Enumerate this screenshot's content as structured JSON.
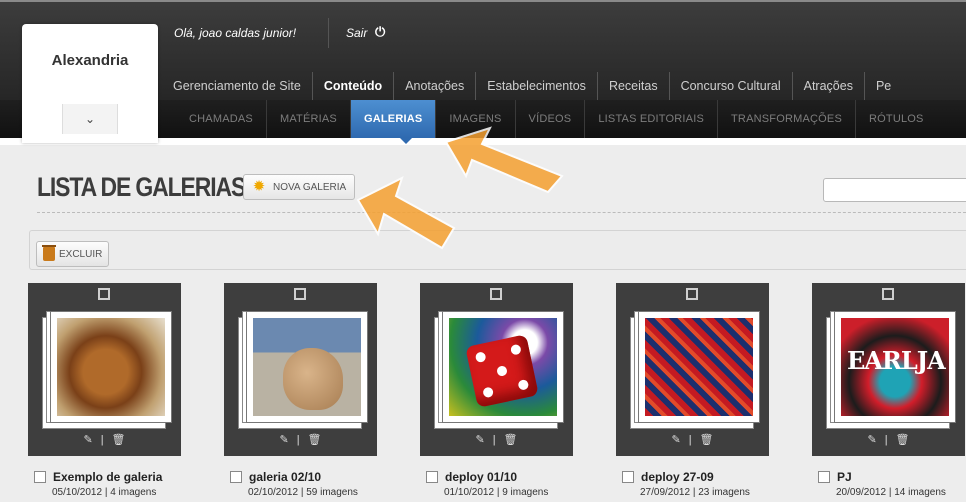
{
  "header": {
    "greeting": "Olá, joao caldas junior!",
    "logout_label": "Sair",
    "logout_icon": "power-icon"
  },
  "site_selector": {
    "name": "Alexandria",
    "toggle_icon": "chevron-down-icon"
  },
  "main_nav": {
    "items": [
      {
        "label": "Gerenciamento de Site",
        "active": false
      },
      {
        "label": "Conteúdo",
        "active": true
      },
      {
        "label": "Anotações",
        "active": false
      },
      {
        "label": "Estabelecimentos",
        "active": false
      },
      {
        "label": "Receitas",
        "active": false
      },
      {
        "label": "Concurso Cultural",
        "active": false
      },
      {
        "label": "Atrações",
        "active": false
      },
      {
        "label": "Pe",
        "active": false
      }
    ]
  },
  "sub_nav": {
    "items": [
      {
        "label": "CHAMADAS",
        "active": false
      },
      {
        "label": "MATÉRIAS",
        "active": false
      },
      {
        "label": "GALERIAS",
        "active": true
      },
      {
        "label": "IMAGENS",
        "active": false
      },
      {
        "label": "VÍDEOS",
        "active": false
      },
      {
        "label": "LISTAS EDITORIAIS",
        "active": false
      },
      {
        "label": "TRANSFORMAÇÕES",
        "active": false
      },
      {
        "label": "RÓTULOS",
        "active": false
      }
    ],
    "accent_color": "#2f6ab0"
  },
  "page": {
    "title": "LISTA DE GALERIAS",
    "new_gallery_label": "NOVA GALERIA",
    "new_gallery_icon": "sun-add-icon",
    "search_value": ""
  },
  "toolbar": {
    "delete_label": "EXCLUIR",
    "delete_icon": "trash-icon"
  },
  "galleries": [
    {
      "title": "Exemplo de galeria",
      "date": "05/10/2012",
      "count": "4 imagens",
      "meta": "05/10/2012 | 4 imagens",
      "thumb": "dachshund-puppy"
    },
    {
      "title": "galeria 02/10",
      "date": "02/10/2012",
      "count": "59 imagens",
      "meta": "02/10/2012 | 59 imagens",
      "thumb": "shar-pei"
    },
    {
      "title": "deploy 01/10",
      "date": "01/10/2012",
      "count": "9 imagens",
      "meta": "01/10/2012 | 9 imagens",
      "thumb": "red-dice"
    },
    {
      "title": "deploy 27-09",
      "date": "27/09/2012",
      "count": "23 imagens",
      "meta": "27/09/2012 | 23 imagens",
      "thumb": "red-blue-poster"
    },
    {
      "title": "PJ",
      "date": "20/09/2012",
      "count": "14 imagens",
      "meta": "20/09/2012 | 14 imagens",
      "thumb": "pearl-jam-poster",
      "thumb_text": "EARLJA"
    }
  ],
  "card_actions": {
    "edit_icon": "pencil-icon",
    "delete_icon": "trash-icon",
    "separator": "|"
  },
  "annotation_color": "#f5a030"
}
